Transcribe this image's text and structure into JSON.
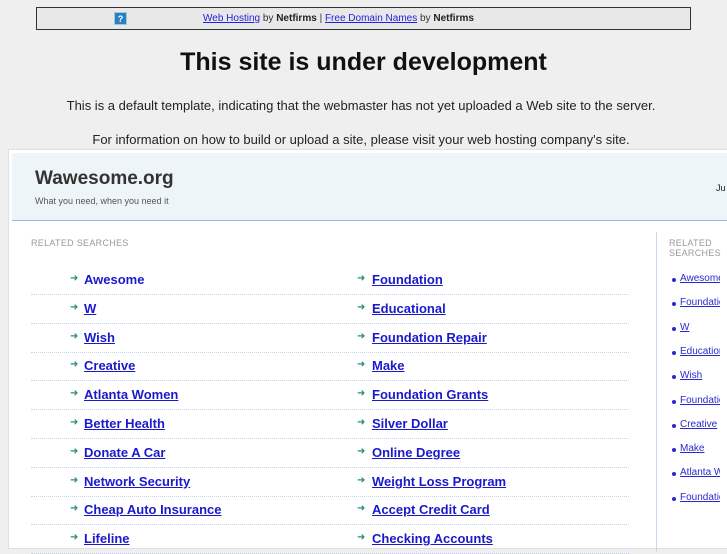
{
  "topbar": {
    "link1": "Web Hosting",
    "by1": "by",
    "brand1": "Netfirms",
    "sep": "|",
    "link2": "Free Domain Names",
    "by2": "by",
    "brand2": "Netfirms",
    "icon": "question-icon"
  },
  "title": "This site is under development",
  "info1": "This is a default template, indicating that the webmaster has not yet uploaded a Web site to the server.",
  "info2": "For information on how to build or upload a site, please visit your web hosting company's site.",
  "site": {
    "name": "Wawesome.org",
    "tagline": "What you need, when you need it",
    "header_right": "Ju"
  },
  "main": {
    "heading": "RELATED SEARCHES",
    "left": [
      "Awesome",
      "W",
      "Wish",
      "Creative",
      "Atlanta Women",
      "Better Health",
      "Donate A Car",
      "Network Security",
      "Cheap Auto Insurance",
      "Lifeline"
    ],
    "right": [
      "Foundation",
      "Educational",
      "Foundation Repair",
      "Make",
      "Foundation Grants",
      "Silver Dollar",
      "Online Degree",
      "Weight Loss Program",
      "Accept Credit Card",
      "Checking Accounts"
    ]
  },
  "sidebar": {
    "heading": "RELATED SEARCHES",
    "items": [
      "Awesome",
      "Foundation",
      "W",
      "Educational",
      "Wish",
      "Foundation Repair",
      "Creative",
      "Make",
      "Atlanta Women",
      "Foundation Grants"
    ]
  }
}
